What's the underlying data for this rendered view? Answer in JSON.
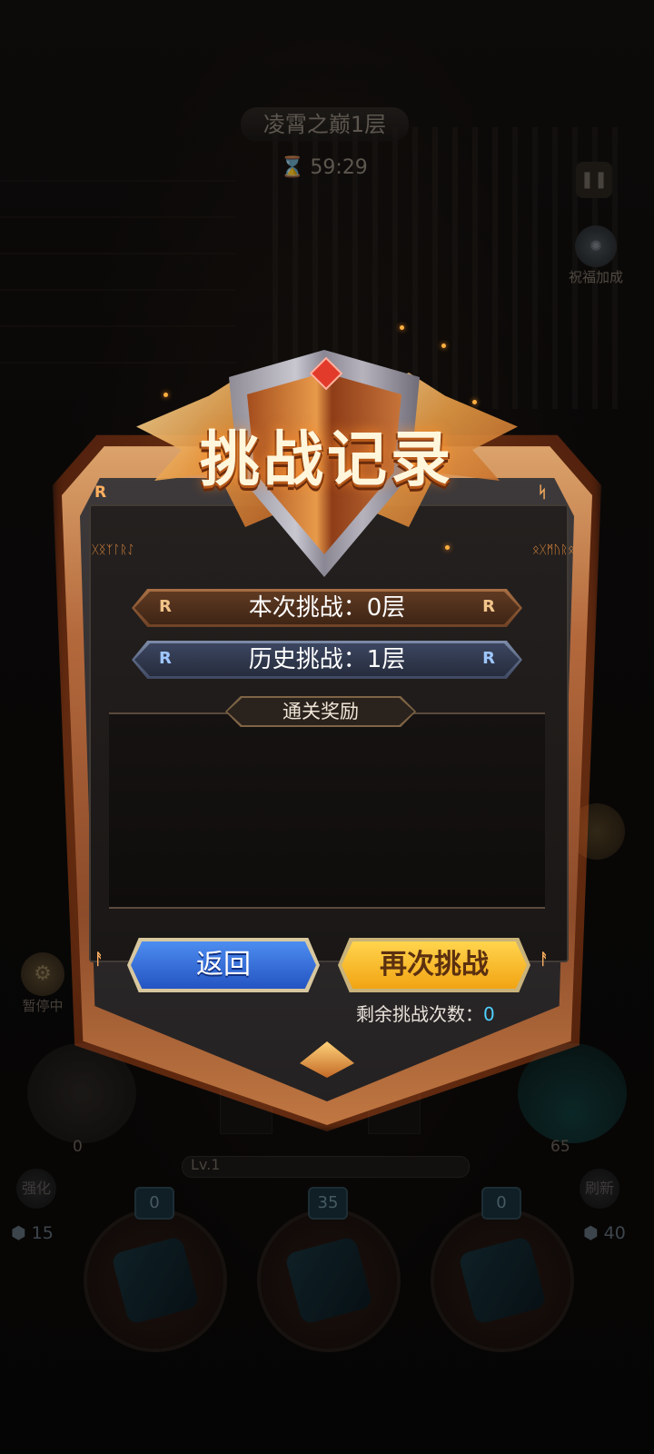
{
  "hud": {
    "stage_title": "凌霄之巅1层",
    "timer": "59:29",
    "bless_label": "祝福加成",
    "paused_label": "暂停中",
    "left_hp": "0",
    "right_hp": "65",
    "level": "Lv.1",
    "enhance_label": "强化",
    "refresh_label": "刷新",
    "left_gems": "15",
    "right_gems": "40",
    "cards": [
      {
        "badge": "0"
      },
      {
        "badge": "35"
      },
      {
        "badge": "0"
      }
    ]
  },
  "modal": {
    "title": "挑战记录",
    "current_challenge": "本次挑战：0层",
    "history_challenge": "历史挑战：1层",
    "reward_label": "通关奖励",
    "back_button": "返回",
    "again_button": "再次挑战",
    "remaining_label": "剩余挑战次数：",
    "remaining_value": "0",
    "rune_letter": "R",
    "left_runes": "ᚷᛝᛉᛚᚱᛇ",
    "right_runes": "ᛟᚷᛗᚢᚱᛟ"
  },
  "colors": {
    "back_button": "#2f6ad8",
    "again_button": "#f7b92a",
    "remaining_value": "#4fd1ff",
    "frame_glow": "#ff7a28"
  }
}
